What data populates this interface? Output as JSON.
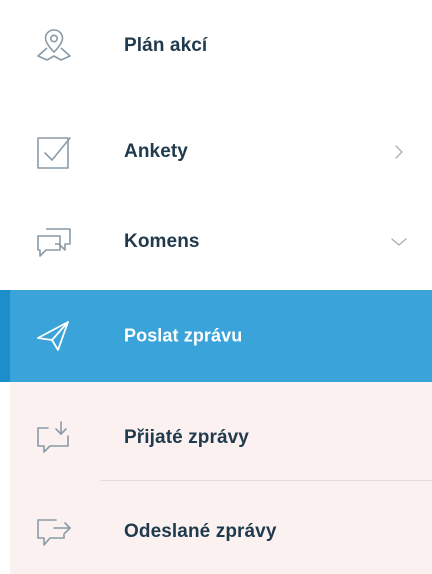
{
  "menu": {
    "items": [
      {
        "label": "Plán akcí",
        "icon": "map-pin-icon"
      },
      {
        "label": "Ankety",
        "icon": "checkbox-icon",
        "chevron": "chevron-right-icon"
      },
      {
        "label": "Komens",
        "icon": "chat-bubbles-icon",
        "chevron": "chevron-down-icon"
      },
      {
        "label": "Poslat zprávu",
        "icon": "paper-plane-icon",
        "active": true
      },
      {
        "label": "Přijaté zprávy",
        "icon": "inbox-message-icon"
      },
      {
        "label": "Odeslané zprávy",
        "icon": "outbox-message-icon"
      }
    ]
  },
  "colors": {
    "accent": "#3aa3d9",
    "text": "#1f3a4d",
    "icon": "#8a9aa6",
    "submenu_bg": "#fbf1f1"
  }
}
